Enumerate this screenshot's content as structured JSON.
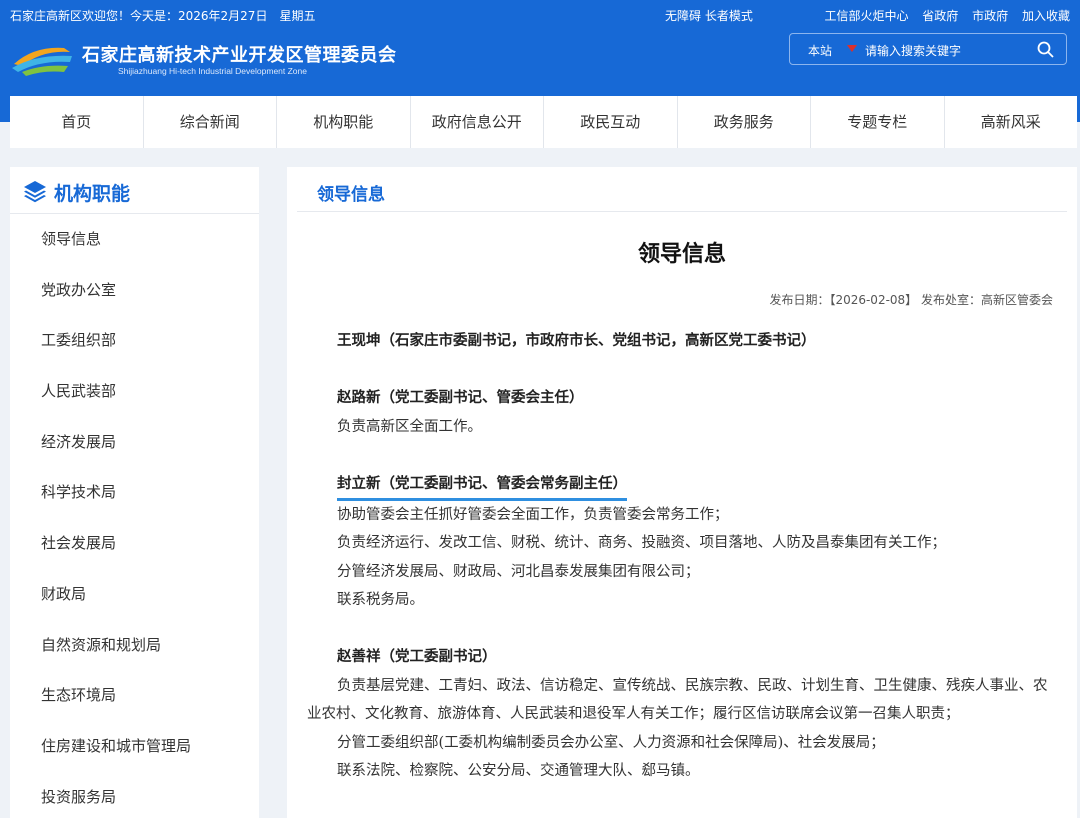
{
  "topbar": {
    "welcome": "石家庄高新区欢迎您！今天是：2026年2月27日　星期五",
    "accessibility": "无障碍 长者模式",
    "links": [
      "工信部火炬中心",
      "省政府",
      "市政府",
      "加入收藏"
    ]
  },
  "site": {
    "title": "石家庄高新技术产业开发区管理委员会",
    "subtitle": "Shijiazhuang Hi-tech Industrial Development Zone"
  },
  "search": {
    "scope": "本站",
    "placeholder": "请输入搜索关键字"
  },
  "nav": [
    "首页",
    "综合新闻",
    "机构职能",
    "政府信息公开",
    "政民互动",
    "政务服务",
    "专题专栏",
    "高新风采"
  ],
  "sidebar": {
    "title": "机构职能",
    "items": [
      "领导信息",
      "党政办公室",
      "工委组织部",
      "人民武装部",
      "经济发展局",
      "科学技术局",
      "社会发展局",
      "财政局",
      "自然资源和规划局",
      "生态环境局",
      "住房建设和城市管理局",
      "投资服务局"
    ]
  },
  "main": {
    "section_title": "领导信息",
    "article_title": "领导信息",
    "meta": "发布日期：【2026-02-08】 发布处室：高新区管委会",
    "blocks": [
      {
        "name": "王现坤（石家庄市委副书记，市政府市长、党组书记，高新区党工委书记）",
        "lines": []
      },
      {
        "name": "赵路新（党工委副书记、管委会主任）",
        "lines": [
          "负责高新区全面工作。"
        ]
      },
      {
        "name": "封立新（党工委副书记、管委会常务副主任）",
        "lines": [
          "协助管委会主任抓好管委会全面工作，负责管委会常务工作；",
          "负责经济运行、发改工信、财税、统计、商务、投融资、项目落地、人防及昌泰集团有关工作；",
          "分管经济发展局、财政局、河北昌泰发展集团有限公司；",
          "联系税务局。"
        ]
      },
      {
        "name": "赵善祥（党工委副书记）",
        "lines": [
          "负责基层党建、工青妇、政法、信访稳定、宣传统战、民族宗教、民政、计划生育、卫生健康、残疾人事业、农业农村、文化教育、旅游体育、人民武装和退役军人有关工作；履行区信访联席会议第一召集人职责；",
          "分管工委组织部(工委机构编制委员会办公室、人力资源和社会保障局)、社会发展局；",
          "联系法院、检察院、公安分局、交通管理大队、郄马镇。"
        ]
      }
    ]
  },
  "colors": {
    "brand": "#1769d6",
    "accent_red": "#d9302c",
    "highlight_underline": "#2f8fe0"
  }
}
